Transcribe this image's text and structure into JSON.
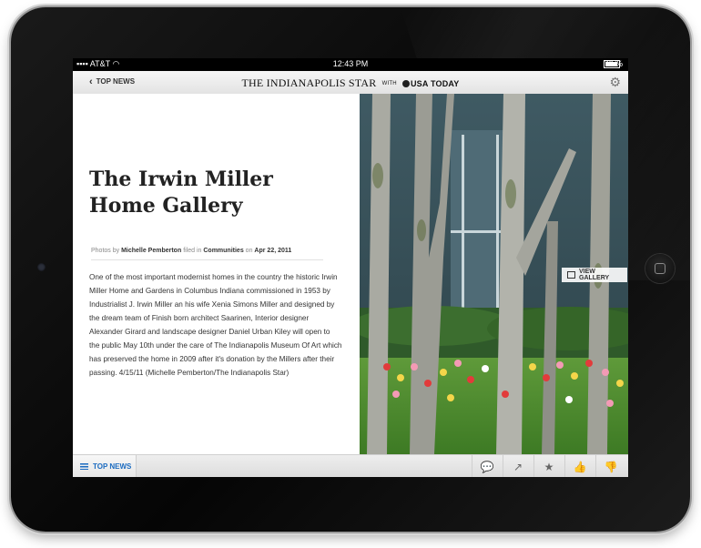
{
  "status": {
    "carrier": "AT&T",
    "time": "12:43 PM",
    "battery": "76 %"
  },
  "nav": {
    "back_label": "TOP NEWS",
    "masthead": "THE INDIANAPOLIS STAR",
    "with": "WITH",
    "partner": "USA TODAY",
    "settings_icon": "gear-icon"
  },
  "article": {
    "title": "The Irwin Miller Home Gallery",
    "byline": {
      "photos_by": "Photos by",
      "author": "Michelle Pemberton",
      "filed_in": "filed in",
      "section": "Communities",
      "on": "on",
      "date": "Apr 22, 2011"
    },
    "body": "One of the most important modernist homes in the country the historic Irwin Miller Home and Gardens in Columbus Indiana commissioned in 1953 by Industrialist J. Irwin Miller an his wife Xenia Simons Miller and designed by the dream team of Finish born architect Saarinen, Interior designer Alexander Girard and landscape designer Daniel Urban Kiley will open to the public May 10th under the care of The Indianapolis Museum Of Art which has preserved the home in 2009 after it's donation by the Millers after their passing. 4/15/11 (Michelle Pemberton/The Indianapolis Star)"
  },
  "photo": {
    "view_gallery_label": "VIEW GALLERY"
  },
  "toolbar": {
    "section_label": "TOP NEWS",
    "icons": [
      "comment-icon",
      "share-icon",
      "star-icon",
      "thumbs-up-icon",
      "thumbs-down-icon"
    ]
  },
  "colors": {
    "accent": "#1b6bc0",
    "bezel": "#0b0b0b"
  }
}
